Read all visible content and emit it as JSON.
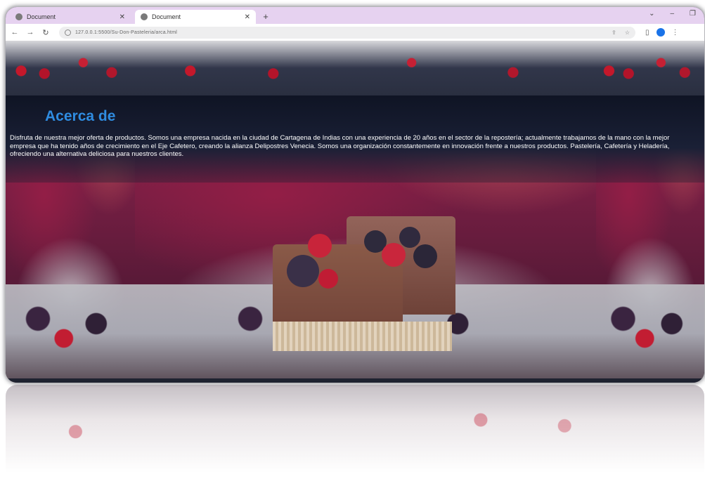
{
  "browser": {
    "tabs": [
      {
        "title": "Document",
        "active": false
      },
      {
        "title": "Document",
        "active": true
      }
    ],
    "new_tab_symbol": "+",
    "url": "127.0.0.1:5500/Su-Don-Pasteleria/arca.html",
    "profile_color": "#1a73e8"
  },
  "page": {
    "about_title": "Acerca de",
    "about_text": "Disfruta de nuestra mejor oferta de productos. Somos una empresa nacida en la ciudad de Cartagena de Indias con una experiencia de 20 años en el sector de la repostería; actualmente trabajamos de la mano con la mejor empresa que ha tenido años de crecimiento en el Eje Cafetero, creando la alianza Delipostres Venecia. Somos una organización constantemente en innovación frente a nuestros productos. Pastelería, Cafetería y Heladería, ofreciendo una alternativa deliciosa para nuestros clientes.",
    "title_color": "#2f8ce0"
  },
  "icons": {
    "back": "arrow-left-icon",
    "forward": "arrow-right-icon",
    "reload": "reload-icon",
    "info": "site-info-icon",
    "share": "share-icon",
    "extensions": "extensions-icon",
    "sidebar": "side-panel-icon",
    "menu": "kebab-menu-icon"
  }
}
